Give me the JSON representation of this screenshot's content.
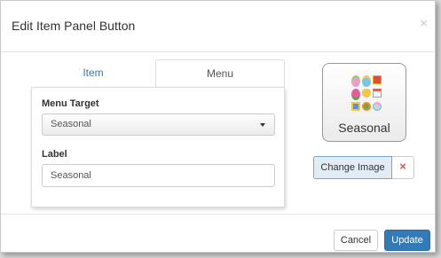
{
  "modal": {
    "title": "Edit Item Panel Button",
    "close_glyph": "×"
  },
  "tabs": [
    {
      "label": "Item",
      "active": false
    },
    {
      "label": "Menu",
      "active": true
    }
  ],
  "menu_form": {
    "target_label": "Menu Target",
    "target_value": "Seasonal",
    "label_label": "Label",
    "label_value": "Seasonal"
  },
  "preview": {
    "label": "Seasonal",
    "icons": [
      "egg-icon",
      "egg-icon",
      "book-icon",
      "rose-icon",
      "bunny-icon",
      "calendar-icon",
      "gift-icon",
      "clover-icon",
      "globe-icon"
    ]
  },
  "image_controls": {
    "change_label": "Change Image",
    "remove_glyph": "×"
  },
  "footer": {
    "cancel_label": "Cancel",
    "update_label": "Update"
  },
  "colors": {
    "primary": "#337ab7",
    "danger": "#d9534f",
    "tab_link": "#337ab7"
  }
}
